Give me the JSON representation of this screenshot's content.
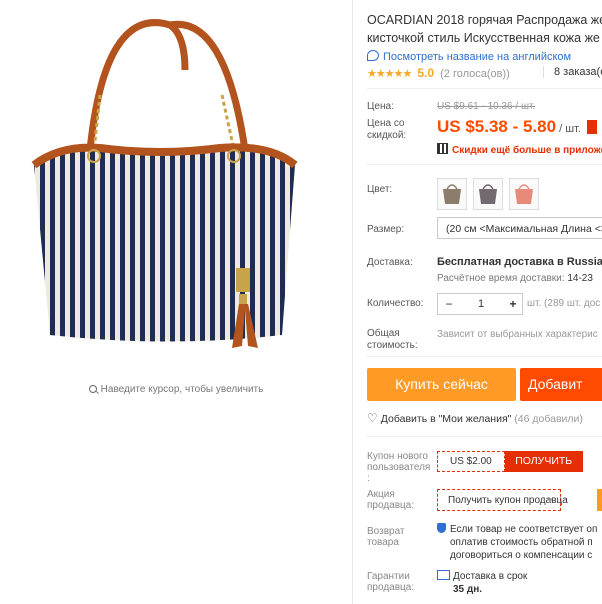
{
  "gallery": {
    "zoom_hint": "Наведите курсор, чтобы увеличить"
  },
  "product": {
    "title_line1": "OCARDIAN 2018 горячая Распродажа же",
    "title_line2": "кисточкой стиль Искусственная кожа же",
    "translate_link": "Посмотреть название на английском",
    "rating": {
      "stars": "★★★★★",
      "score": "5.0",
      "votes": "(2 голоса(ов))",
      "orders": "8 заказа(ов)"
    }
  },
  "price": {
    "label": "Цена:",
    "old": "US $9.61 - 10.36 / шт.",
    "discount_label_1": "Цена со",
    "discount_label_2": "скидкой:",
    "current": "US $5.38 - 5.80",
    "unit": "/ шт.",
    "app_discount": "Скидки ещё больше в приложе"
  },
  "options": {
    "color_label": "Цвет:",
    "colors": [
      "#8c7c6c",
      "#726a6e",
      "#e88a7a"
    ],
    "size_label": "Размер:",
    "size_value": "(20 см <Максимальная Длина <30",
    "shipping_label": "Доставка:",
    "shipping_main": "Бесплатная доставка в Russian F",
    "shipping_time_label": "Расчётное время доставки:",
    "shipping_time_value": "14-23",
    "qty_label": "Количество:",
    "qty_minus": "−",
    "qty_value": "1",
    "qty_plus": "+",
    "qty_note": "шт. (289 шт. дос",
    "total_label_1": "Общая",
    "total_label_2": "стоимость:",
    "total_note": "Зависит от выбранных характерис"
  },
  "actions": {
    "buy_now": "Купить сейчас",
    "add_to_cart": "Добавит",
    "wishlist": "Добавить в \"Мои желания\"",
    "wishlist_count": "(46 добавили)"
  },
  "coupons": {
    "new_user_label_1": "Купон нового",
    "new_user_label_2": "пользователя",
    "new_user_label_3": ":",
    "new_user_amount": "US $2.00",
    "new_user_get": "ПОЛУЧИТЬ",
    "seller_label_1": "Акция",
    "seller_label_2": "продавца:",
    "seller_button": "Получить купон продавца",
    "seller_caret": "▼"
  },
  "returns": {
    "label_1": "Возврат",
    "label_2": "товара",
    "line1": "Если товар не соответствует оп",
    "line2": "оплатив стоимость обратной п",
    "line3": "договориться о компенсации с"
  },
  "guarantee": {
    "label_1": "Гарантии",
    "label_2": "продавца:",
    "line1": "Доставка в срок",
    "line2": "35 дн."
  }
}
